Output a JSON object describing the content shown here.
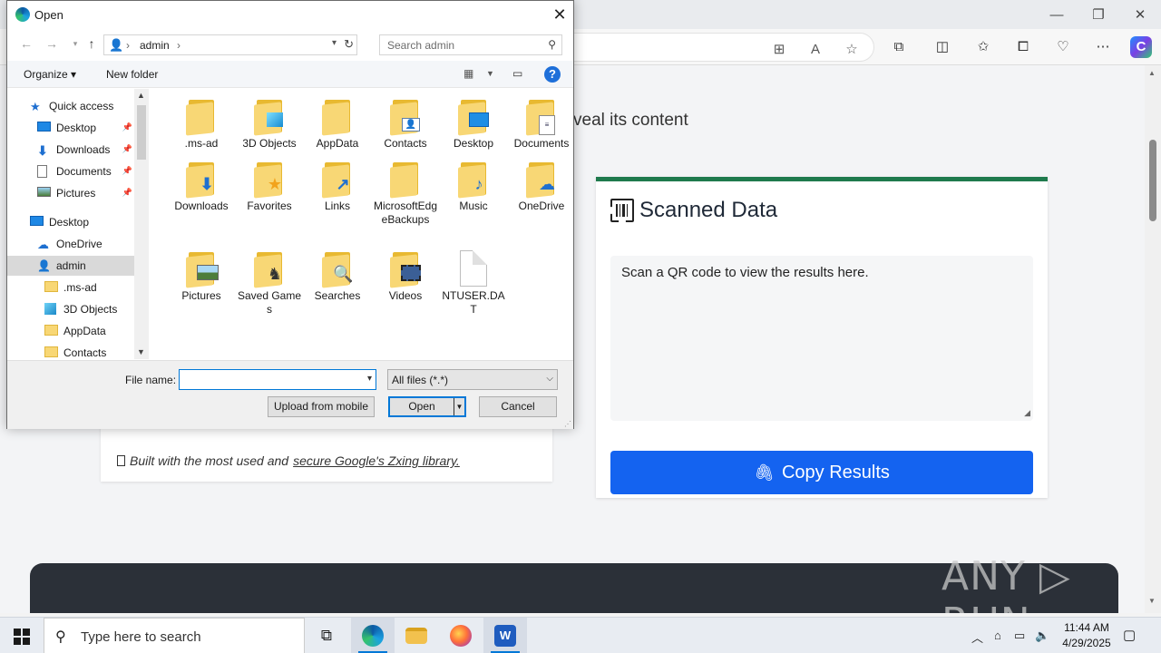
{
  "browser": {
    "window_controls": [
      "—",
      "❐",
      "✕"
    ]
  },
  "page": {
    "reveal_text": "veal its content",
    "scanned_card": {
      "title": "Scanned Data",
      "textarea_text": "Scan a QR code to view the results here.",
      "copy_button_label": "Copy Results"
    },
    "built_text_prefix": "Built with the most used and",
    "built_text_link": "secure Google's Zxing library."
  },
  "watermark": "ANY ▷ RUN",
  "dialog": {
    "title": "Open",
    "path": [
      "admin"
    ],
    "search_placeholder": "Search admin",
    "commands": {
      "organize": "Organize ▾",
      "new_folder": "New folder"
    },
    "tree": [
      {
        "label": "Quick access",
        "icon": "star",
        "indent": 1,
        "pinned": false
      },
      {
        "label": "Desktop",
        "icon": "desktop",
        "indent": 2,
        "pinned": true
      },
      {
        "label": "Downloads",
        "icon": "download",
        "indent": 2,
        "pinned": true
      },
      {
        "label": "Documents",
        "icon": "doc",
        "indent": 2,
        "pinned": true
      },
      {
        "label": "Pictures",
        "icon": "pic",
        "indent": 2,
        "pinned": true
      },
      {
        "label": "Desktop",
        "icon": "desktop",
        "indent": 1,
        "pinned": false
      },
      {
        "label": "OneDrive",
        "icon": "cloud",
        "indent": 2,
        "pinned": false
      },
      {
        "label": "admin",
        "icon": "user",
        "indent": 2,
        "pinned": false,
        "selected": true
      },
      {
        "label": ".ms-ad",
        "icon": "folder",
        "indent": 3,
        "pinned": false
      },
      {
        "label": "3D Objects",
        "icon": "cube",
        "indent": 3,
        "pinned": false
      },
      {
        "label": "AppData",
        "icon": "folder",
        "indent": 3,
        "pinned": false
      },
      {
        "label": "Contacts",
        "icon": "contact",
        "indent": 3,
        "pinned": false
      }
    ],
    "files": [
      {
        "name": ".ms-ad",
        "kind": "folder",
        "overlay": ""
      },
      {
        "name": "3D Objects",
        "kind": "folder",
        "overlay": "cube"
      },
      {
        "name": "AppData",
        "kind": "folder",
        "overlay": ""
      },
      {
        "name": "Contacts",
        "kind": "folder",
        "overlay": "contact"
      },
      {
        "name": "Desktop",
        "kind": "folder",
        "overlay": "desktop"
      },
      {
        "name": "Documents",
        "kind": "folder",
        "overlay": "doc"
      },
      {
        "name": "Downloads",
        "kind": "folder",
        "overlay": "download"
      },
      {
        "name": "Favorites",
        "kind": "folder",
        "overlay": "star"
      },
      {
        "name": "Links",
        "kind": "folder",
        "overlay": "link"
      },
      {
        "name": "MicrosoftEdgeBackups",
        "kind": "folder",
        "overlay": ""
      },
      {
        "name": "Music",
        "kind": "folder",
        "overlay": "music"
      },
      {
        "name": "OneDrive",
        "kind": "folder",
        "overlay": "cloud"
      },
      {
        "name": "Pictures",
        "kind": "folder",
        "overlay": "pic"
      },
      {
        "name": "Saved Games",
        "kind": "folder",
        "overlay": "chess"
      },
      {
        "name": "Searches",
        "kind": "folder",
        "overlay": "search"
      },
      {
        "name": "Videos",
        "kind": "folder",
        "overlay": "film"
      },
      {
        "name": "NTUSER.DAT",
        "kind": "file",
        "overlay": ""
      }
    ],
    "file_name_label": "File name:",
    "file_name_value": "",
    "file_type": "All files (*.*)",
    "buttons": {
      "upload": "Upload from mobile",
      "open": "Open",
      "cancel": "Cancel"
    }
  },
  "taskbar": {
    "search_placeholder": "Type here to search",
    "time": "11:44 AM",
    "date": "4/29/2025"
  },
  "colors": {
    "accent_blue": "#1463f0",
    "card_top_green": "#1f7a4d",
    "folder_yellow": "#f8d775"
  }
}
